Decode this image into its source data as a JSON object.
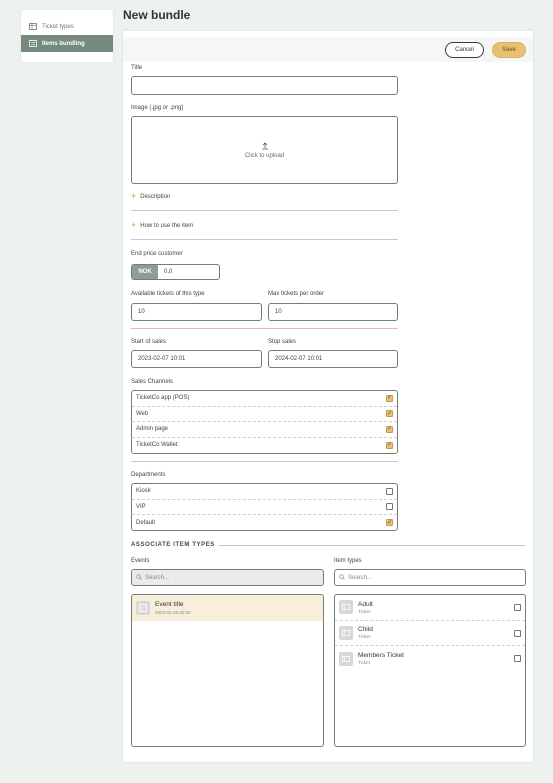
{
  "sidebar": {
    "items": [
      {
        "label": "Ticket types",
        "icon": "table-icon",
        "active": false
      },
      {
        "label": "Items bundling",
        "icon": "list-icon",
        "active": true
      }
    ]
  },
  "page": {
    "title": "New bundle"
  },
  "toolbar": {
    "cancel_label": "Cancel",
    "save_label": "Save",
    "save_color": "#e7c16f"
  },
  "form": {
    "title_label": "Title",
    "title_value": "",
    "image_label": "Image (.jpg or .png)",
    "upload_text": "Click to upload",
    "description_label": "Description",
    "howto_label": "How to use the item",
    "price_label": "End price customer",
    "currency": "NOK",
    "price_value": "0,0",
    "available_label": "Available tickets of this type",
    "available_value": "10",
    "max_label": "Max tickets per order",
    "max_value": "10",
    "start_label": "Start of sales",
    "start_value": "2023-02-07 10:01",
    "stop_label": "Stop sales",
    "stop_value": "2024-02-07 10:01",
    "channels_label": "Sales Channels",
    "channels": [
      {
        "label": "TicketCo app (POS)",
        "checked": true
      },
      {
        "label": "Web",
        "checked": true
      },
      {
        "label": "Admin page",
        "checked": true
      },
      {
        "label": "TicketCo Wallet",
        "checked": true
      }
    ],
    "departments_label": "Departments",
    "departments": [
      {
        "label": "Kiosk",
        "checked": false
      },
      {
        "label": "VIP",
        "checked": false
      },
      {
        "label": "Default",
        "checked": true
      }
    ]
  },
  "associate": {
    "heading": "ASSOCIATE ITEM TYPES",
    "events_label": "Events",
    "events_search_placeholder": "Search...",
    "events": [
      {
        "title": "Event title",
        "date": "2023-02-28 02:00"
      }
    ],
    "item_types_label": "Item types",
    "items_search_placeholder": "Search...",
    "item_types": [
      {
        "name": "Adult",
        "sub": "Ticket",
        "checked": false
      },
      {
        "name": "Child",
        "sub": "Ticket",
        "checked": false
      },
      {
        "name": "Members Ticket",
        "sub": "Ticket",
        "checked": false
      }
    ]
  }
}
